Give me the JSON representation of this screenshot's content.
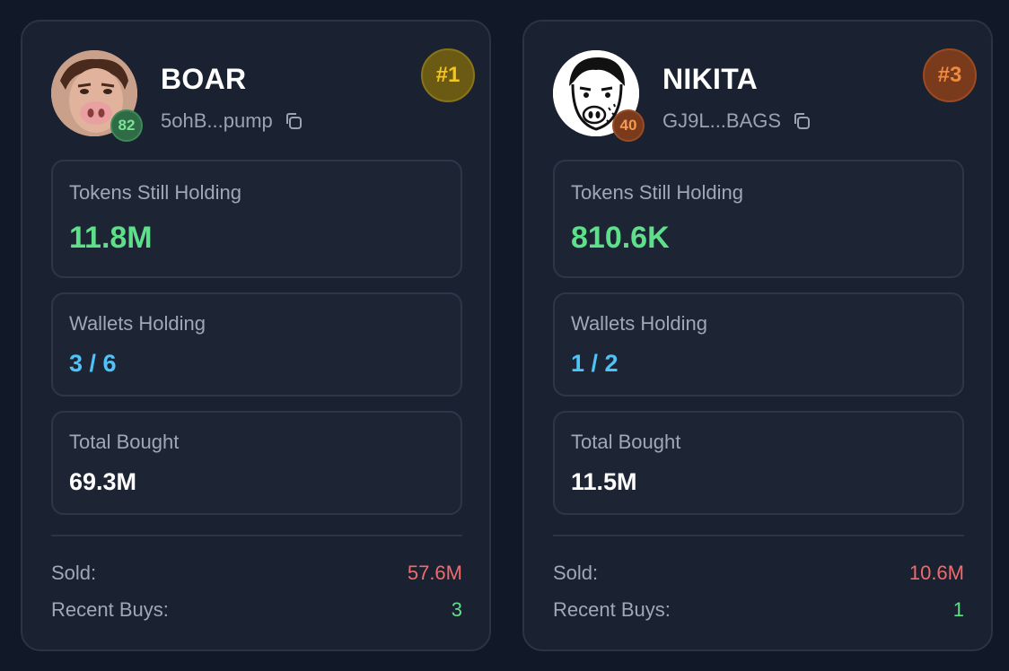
{
  "cards": [
    {
      "name": "BOAR",
      "address": "5ohB...pump",
      "score": "82",
      "rank": "#1",
      "tokens_label": "Tokens Still Holding",
      "tokens_value": "11.8M",
      "wallets_label": "Wallets Holding",
      "wallets_value": "3 / 6",
      "bought_label": "Total Bought",
      "bought_value": "69.3M",
      "sold_label": "Sold:",
      "sold_value": "57.6M",
      "recent_label": "Recent Buys:",
      "recent_value": "3"
    },
    {
      "name": "NIKITA",
      "address": "GJ9L...BAGS",
      "score": "40",
      "rank": "#3",
      "tokens_label": "Tokens Still Holding",
      "tokens_value": "810.6K",
      "wallets_label": "Wallets Holding",
      "wallets_value": "1 / 2",
      "bought_label": "Total Bought",
      "bought_value": "11.5M",
      "sold_label": "Sold:",
      "sold_value": "10.6M",
      "recent_label": "Recent Buys:",
      "recent_value": "1"
    }
  ],
  "colors": {
    "background": "#111827",
    "card": "#1a2130",
    "positive": "#5ee08a",
    "negative": "#f06b6b",
    "wallets": "#4fc3f7",
    "rank_gold": "#f5c518",
    "rank_bronze": "#f08a3c"
  },
  "icons": {
    "copy": "copy-icon",
    "avatar_1": "boar-avatar",
    "avatar_2": "nikita-avatar"
  }
}
